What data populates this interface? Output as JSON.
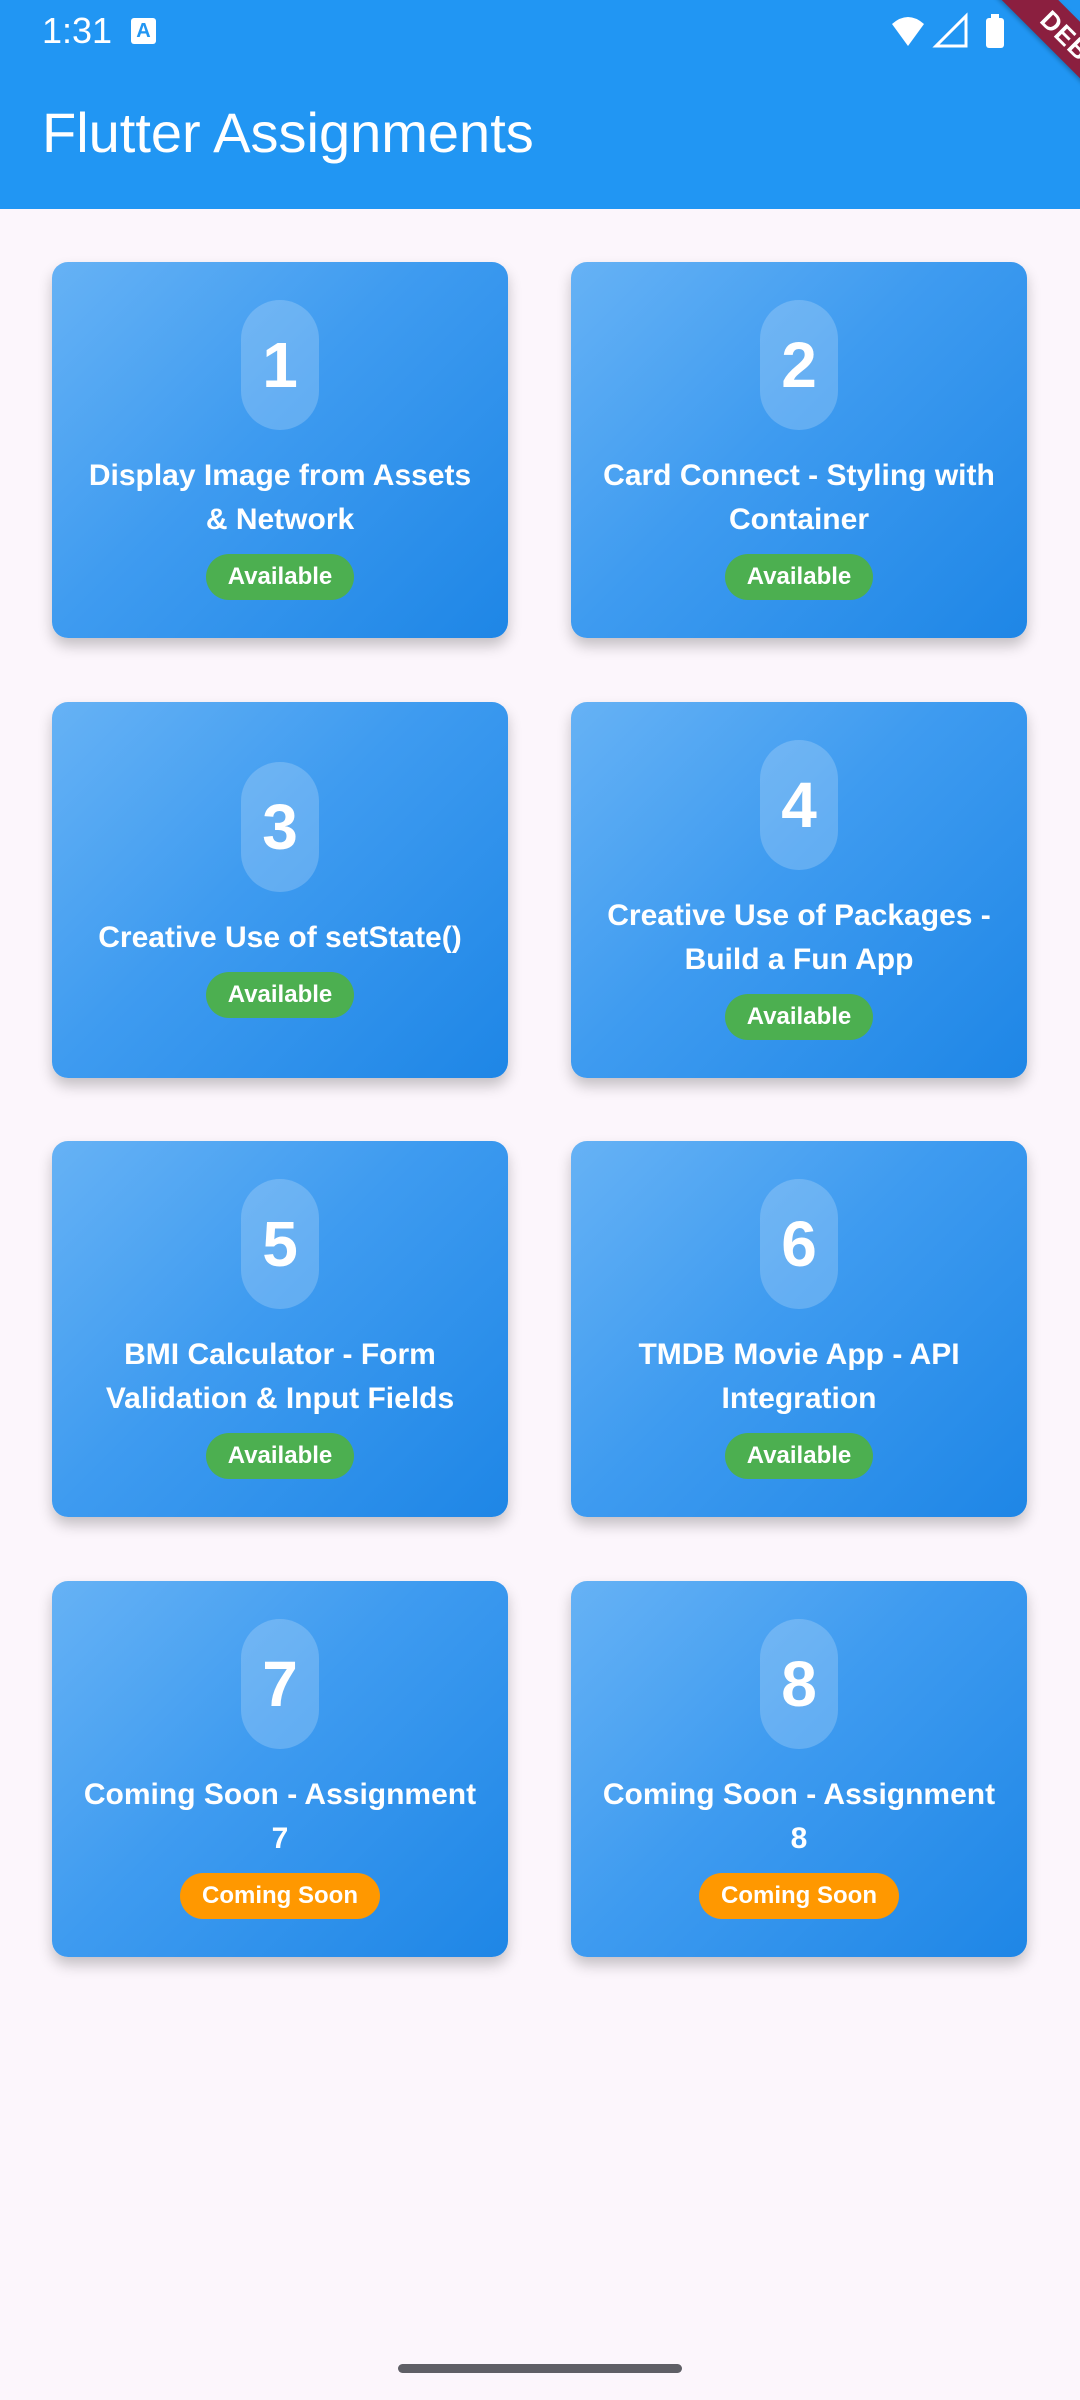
{
  "status_bar": {
    "time": "1:31",
    "notification_icon": "a-icon",
    "icons": [
      "wifi-icon",
      "cell-signal-icon",
      "battery-icon"
    ]
  },
  "app_bar": {
    "title": "Flutter Assignments"
  },
  "debug_banner": {
    "label": "DEBUG"
  },
  "colors": {
    "app_bar": "#2196f3",
    "card_gradient_start": "#66b2f5",
    "card_gradient_end": "#1e86e6",
    "badge_available": "#4caf50",
    "badge_coming_soon": "#ff9800",
    "background": "#fcf6fc"
  },
  "assignments": [
    {
      "number": "1",
      "title": "Display Image from Assets & Network",
      "status": "Available"
    },
    {
      "number": "2",
      "title": "Card Connect - Styling with Container",
      "status": "Available"
    },
    {
      "number": "3",
      "title": "Creative Use of setState()",
      "status": "Available"
    },
    {
      "number": "4",
      "title": "Creative Use of Packages - Build a Fun App",
      "status": "Available"
    },
    {
      "number": "5",
      "title": "BMI Calculator - Form Validation & Input Fields",
      "status": "Available"
    },
    {
      "number": "6",
      "title": "TMDB Movie App - API Integration",
      "status": "Available"
    },
    {
      "number": "7",
      "title": "Coming Soon - Assignment 7",
      "status": "Coming Soon"
    },
    {
      "number": "8",
      "title": "Coming Soon - Assignment 8",
      "status": "Coming Soon"
    }
  ]
}
